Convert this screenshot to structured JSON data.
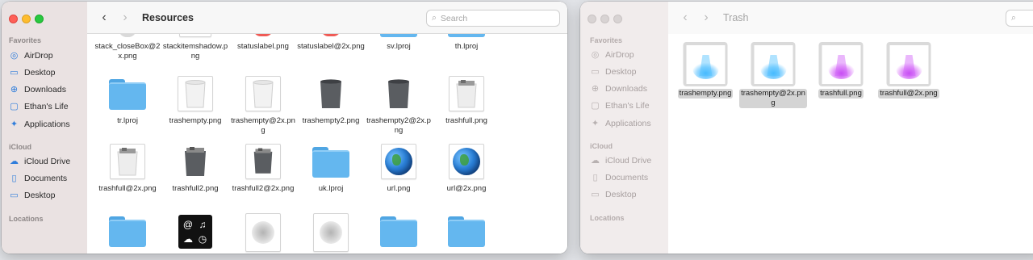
{
  "front_window": {
    "title": "Resources",
    "search_placeholder": "Search",
    "sidebar": {
      "favorites_header": "Favorites",
      "favorites": [
        {
          "label": "AirDrop",
          "icon": "airdrop-icon"
        },
        {
          "label": "Desktop",
          "icon": "desktop-icon"
        },
        {
          "label": "Downloads",
          "icon": "downloads-icon"
        },
        {
          "label": "Ethan's Life",
          "icon": "folder-icon"
        },
        {
          "label": "Applications",
          "icon": "applications-icon"
        }
      ],
      "icloud_header": "iCloud",
      "icloud": [
        {
          "label": "iCloud Drive",
          "icon": "cloud-icon"
        },
        {
          "label": "Documents",
          "icon": "document-icon"
        },
        {
          "label": "Desktop",
          "icon": "desktop-icon"
        }
      ],
      "locations_header": "Locations"
    },
    "files": {
      "row0": [
        "stack_closeBox@2x.png",
        "stackitemshadow.png",
        "statuslabel.png",
        "statuslabel@2x.png",
        "sv.lproj",
        "th.lproj"
      ],
      "row1": [
        "tr.lproj",
        "trashempty.png",
        "trashempty@2x.png",
        "trashempty2.png",
        "trashempty2@2x.png",
        "trashfull.png"
      ],
      "row2": [
        "trashfull@2x.png",
        "trashfull2.png",
        "trashfull2@2x.png",
        "uk.lproj",
        "url.png",
        "url@2x.png"
      ],
      "row3_symbols": [
        "@",
        "♫",
        "☁",
        "◷"
      ]
    }
  },
  "back_window": {
    "title": "Trash",
    "sidebar": {
      "favorites_header": "Favorites",
      "favorites": [
        "AirDrop",
        "Desktop",
        "Downloads",
        "Ethan's Life",
        "Applications"
      ],
      "icloud_header": "iCloud",
      "icloud": [
        "iCloud Drive",
        "Documents",
        "Desktop"
      ],
      "locations_header": "Locations"
    },
    "files": [
      "trashempty.png",
      "trashempty@2x.png",
      "trashfull.png",
      "trashfull@2x.png"
    ]
  },
  "colors": {
    "close": "#fe5f57",
    "minimize": "#febc2e",
    "zoom": "#28c840",
    "accent": "#2f7ddb",
    "folder": "#64b7ef",
    "blue_glow": "#3fb5ff",
    "purple_glow": "#c040f0"
  }
}
